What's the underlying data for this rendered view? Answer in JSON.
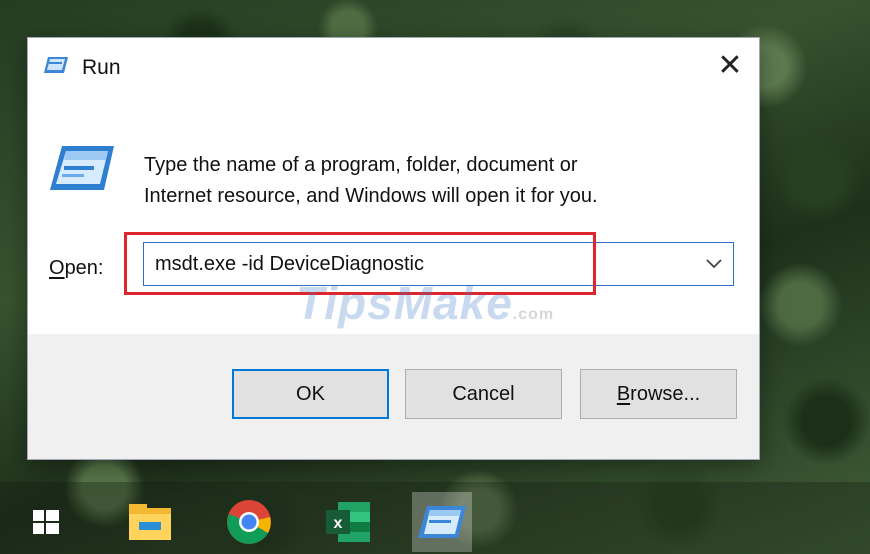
{
  "window": {
    "title": "Run",
    "close_symbol": "✕"
  },
  "content": {
    "description_line1": "Type the name of a program, folder, document or",
    "description_line2": "Internet resource, and Windows will open it for you.",
    "open_label_accel": "O",
    "open_label_rest": "pen:",
    "command_value": "msdt.exe -id DeviceDiagnostic",
    "dropdown_icon": "chevron-down-icon"
  },
  "buttons": {
    "ok": "OK",
    "cancel": "Cancel",
    "browse_accel": "B",
    "browse_rest": "rowse..."
  },
  "watermark": {
    "brand": "TipsMake",
    "suffix": ".com"
  },
  "taskbar": {
    "items": [
      {
        "name": "start-icon"
      },
      {
        "name": "file-explorer-icon"
      },
      {
        "name": "chrome-icon"
      },
      {
        "name": "excel-icon",
        "label": "x"
      },
      {
        "name": "run-taskbar-icon"
      }
    ]
  },
  "colors": {
    "highlight": "#e0262d",
    "focus_border": "#0078d7",
    "footer_bg": "#f0f0f0"
  }
}
